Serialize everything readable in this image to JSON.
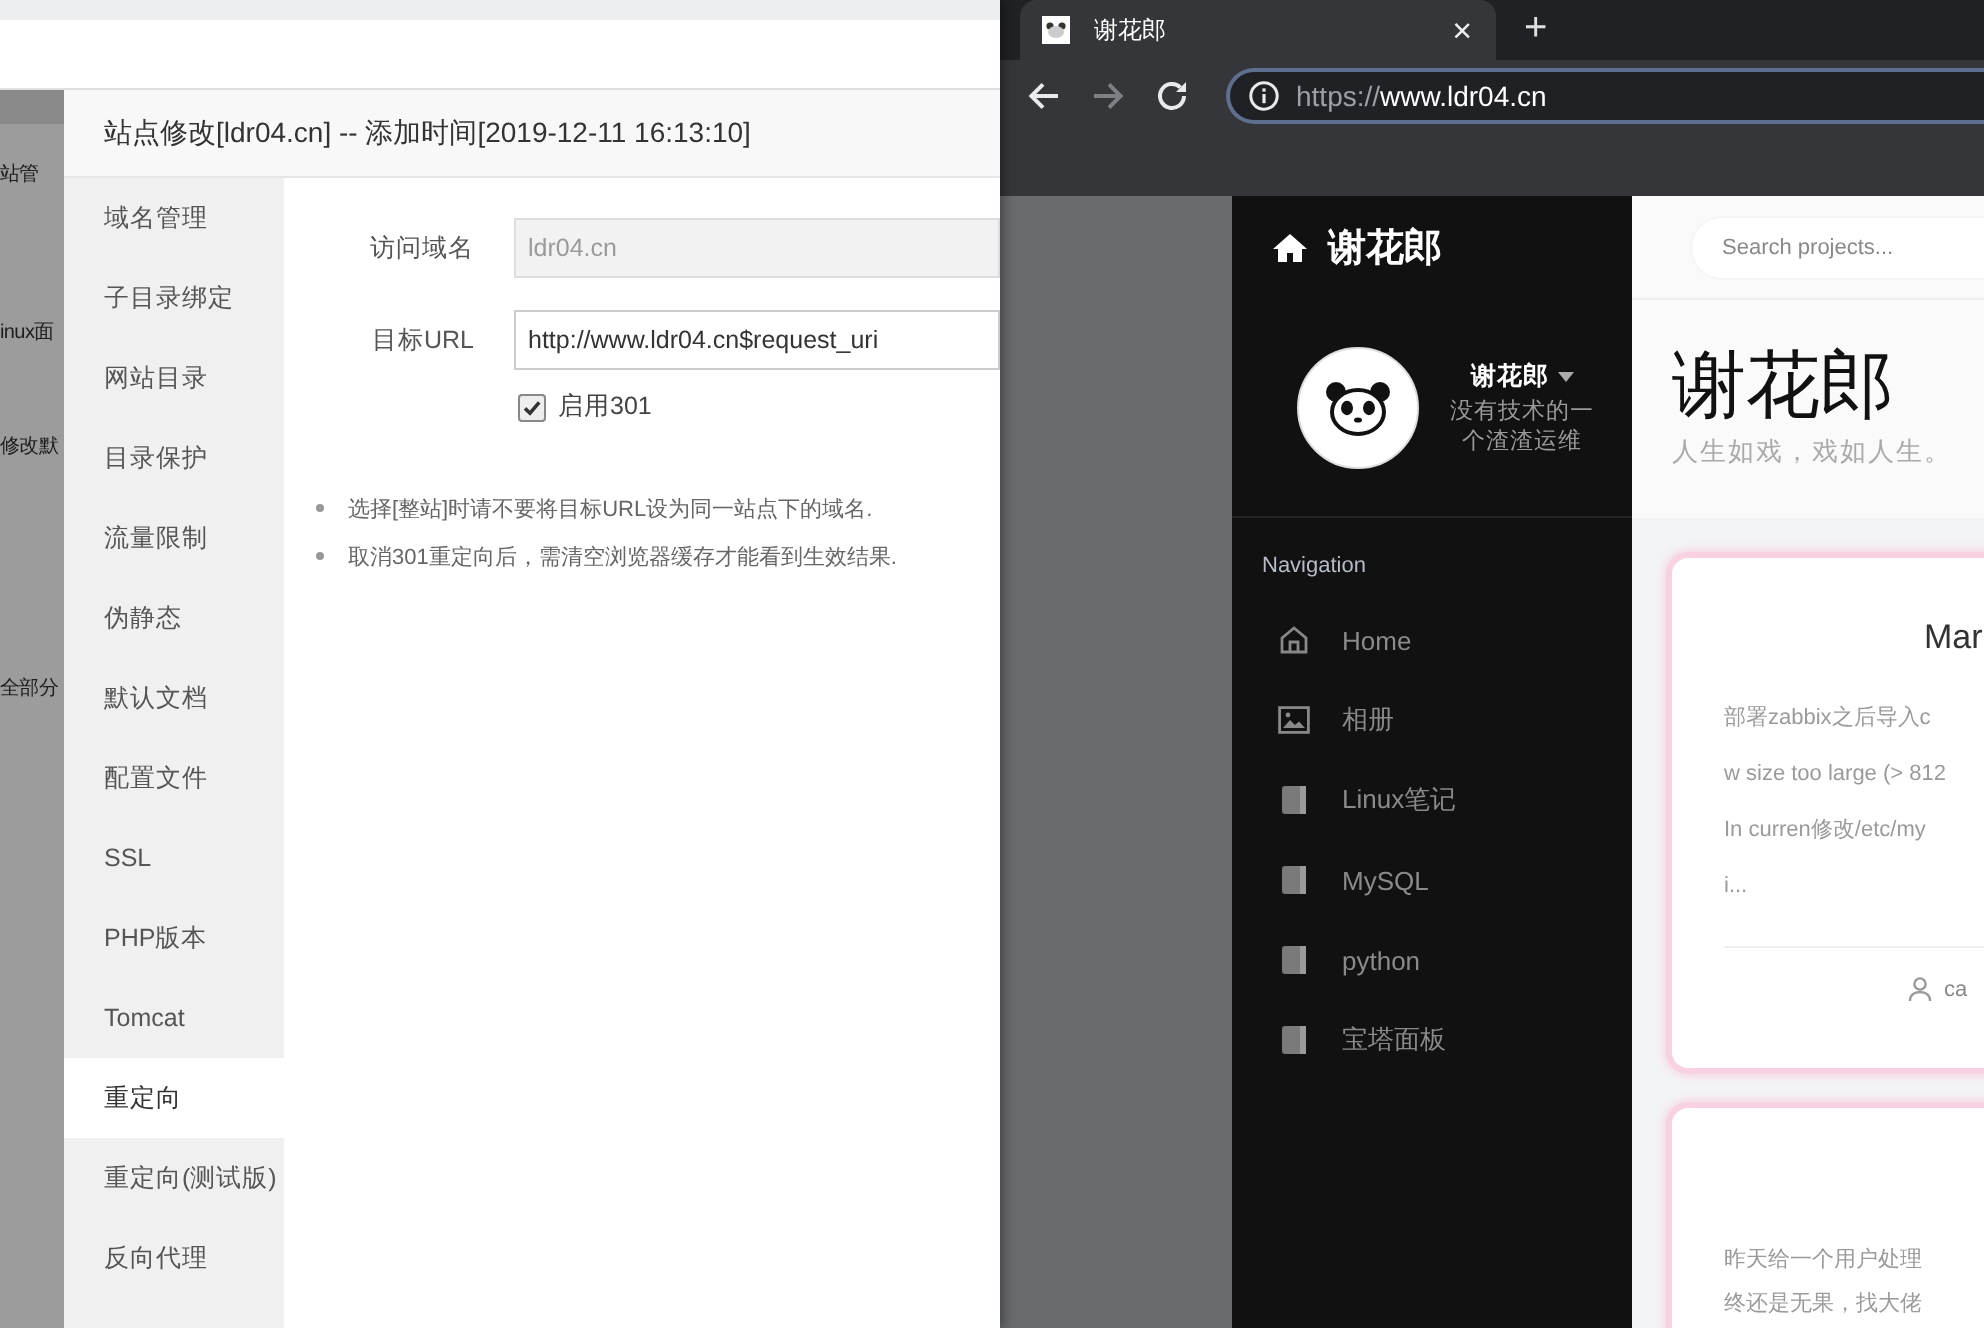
{
  "background_page": {
    "fragments": [
      "站管",
      "inux面",
      "修改默",
      "全部分"
    ]
  },
  "dialog": {
    "title": "站点修改[ldr04.cn] -- 添加时间[2019-12-11 16:13:10]",
    "menu": [
      {
        "label": "域名管理",
        "selected": false
      },
      {
        "label": "子目录绑定",
        "selected": false
      },
      {
        "label": "网站目录",
        "selected": false
      },
      {
        "label": "目录保护",
        "selected": false
      },
      {
        "label": "流量限制",
        "selected": false
      },
      {
        "label": "伪静态",
        "selected": false
      },
      {
        "label": "默认文档",
        "selected": false
      },
      {
        "label": "配置文件",
        "selected": false
      },
      {
        "label": "SSL",
        "selected": false
      },
      {
        "label": "PHP版本",
        "selected": false
      },
      {
        "label": "Tomcat",
        "selected": false
      },
      {
        "label": "重定向",
        "selected": true
      },
      {
        "label": "重定向(测试版)",
        "selected": false
      },
      {
        "label": "反向代理",
        "selected": false
      }
    ],
    "fields": [
      {
        "label": "访问域名",
        "value": "ldr04.cn",
        "disabled": true
      },
      {
        "label": "目标URL",
        "value": "http://www.ldr04.cn$request_uri",
        "disabled": false
      }
    ],
    "checkbox": {
      "label": "启用301",
      "checked": true
    },
    "notes": [
      "选择[整站]时请不要将目标URL设为同一站点下的域名.",
      "取消301重定向后，需清空浏览器缓存才能看到生效结果."
    ]
  },
  "browser": {
    "tab": {
      "title": "谢花郎",
      "close": "×"
    },
    "new_tab": "+",
    "url": {
      "scheme": "https://",
      "host": "www.ldr04.cn"
    },
    "forward_disabled": true
  },
  "site": {
    "brand": "谢花郎",
    "profile": {
      "name": "谢花郎",
      "bio": "没有技术的一个渣渣运维"
    },
    "nav_heading": "Navigation",
    "nav": [
      {
        "label": "Home",
        "kind": "home"
      },
      {
        "label": "相册",
        "kind": "gallery"
      },
      {
        "label": "Linux笔记",
        "kind": "book"
      },
      {
        "label": "MySQL",
        "kind": "book"
      },
      {
        "label": "python",
        "kind": "book"
      },
      {
        "label": "宝塔面板",
        "kind": "book"
      }
    ],
    "search": {
      "placeholder": "Search projects..."
    },
    "title": "谢花郎",
    "subtitle": "人生如戏，戏如人生。",
    "posts": [
      {
        "title": "Mar",
        "excerpt": [
          "部署zabbix之后导入c",
          "w size too large (> 812",
          "In curren修改/etc/my",
          "i..."
        ],
        "author": "ca"
      },
      {
        "excerpt": [
          "昨天给一个用户处理",
          "终还是无果，找大佬"
        ]
      }
    ]
  }
}
